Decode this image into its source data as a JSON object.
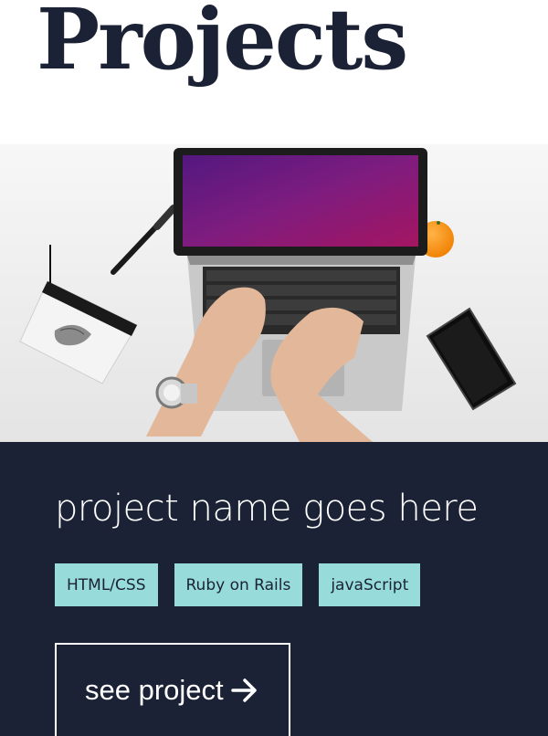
{
  "page": {
    "title": "Projects"
  },
  "hero": {
    "image_icon": "laptop-desk-photo"
  },
  "project": {
    "name": "project name goes here",
    "tags": [
      "HTML/CSS",
      "Ruby on Rails",
      "javaScript"
    ],
    "cta_label": "see project",
    "cta_icon": "arrow-right-icon"
  },
  "colors": {
    "navy": "#1b2235",
    "tag_bg": "#97dcdb",
    "white": "#ffffff"
  }
}
